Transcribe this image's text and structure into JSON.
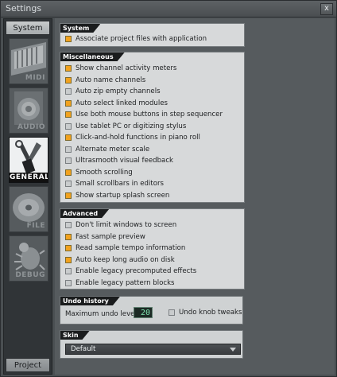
{
  "window": {
    "title": "Settings",
    "close_glyph": "x"
  },
  "sidebar": {
    "top_button": "System",
    "bottom_button": "Project",
    "items": [
      {
        "label": "MIDI",
        "icon": "midi-keyboard-icon"
      },
      {
        "label": "AUDIO",
        "icon": "speaker-icon"
      },
      {
        "label": "GENERAL",
        "icon": "tools-icon",
        "active": true
      },
      {
        "label": "FILE",
        "icon": "disc-icon"
      },
      {
        "label": "DEBUG",
        "icon": "bug-icon"
      }
    ]
  },
  "system_panel": {
    "title": "System",
    "items": [
      {
        "label": "Associate project files with application",
        "checked": true
      }
    ]
  },
  "misc_panel": {
    "title": "Miscellaneous",
    "items": [
      {
        "label": "Show channel activity meters",
        "checked": true
      },
      {
        "label": "Auto name channels",
        "checked": true
      },
      {
        "label": "Auto zip empty channels",
        "checked": false
      },
      {
        "label": "Auto select linked modules",
        "checked": true
      },
      {
        "label": "Use both mouse buttons in step sequencer",
        "checked": true
      },
      {
        "label": "Use tablet PC or digitizing stylus",
        "checked": false
      },
      {
        "label": "Click-and-hold functions in piano roll",
        "checked": true
      },
      {
        "label": "Alternate meter scale",
        "checked": false
      },
      {
        "label": "Ultrasmooth visual feedback",
        "checked": false
      },
      {
        "label": "Smooth scrolling",
        "checked": true
      },
      {
        "label": "Small scrollbars in editors",
        "checked": false
      },
      {
        "label": "Show startup splash screen",
        "checked": true
      }
    ]
  },
  "advanced_panel": {
    "title": "Advanced",
    "items": [
      {
        "label": "Don't limit windows to screen",
        "checked": false
      },
      {
        "label": "Fast sample preview",
        "checked": true
      },
      {
        "label": "Read sample tempo information",
        "checked": true
      },
      {
        "label": "Auto keep long audio on disk",
        "checked": true
      },
      {
        "label": "Enable legacy precomputed effects",
        "checked": false
      },
      {
        "label": "Enable legacy pattern blocks",
        "checked": false
      }
    ]
  },
  "undo_panel": {
    "title": "Undo history",
    "max_label": "Maximum undo levels:",
    "max_value": "20",
    "knob_label": "Undo knob tweaks",
    "knob_checked": false
  },
  "skin_panel": {
    "title": "Skin",
    "selected": "Default"
  },
  "colors": {
    "checkbox_on": "#f2a21e",
    "panel_bg": "#d7d9da",
    "header_bg": "#1a1c1d"
  }
}
